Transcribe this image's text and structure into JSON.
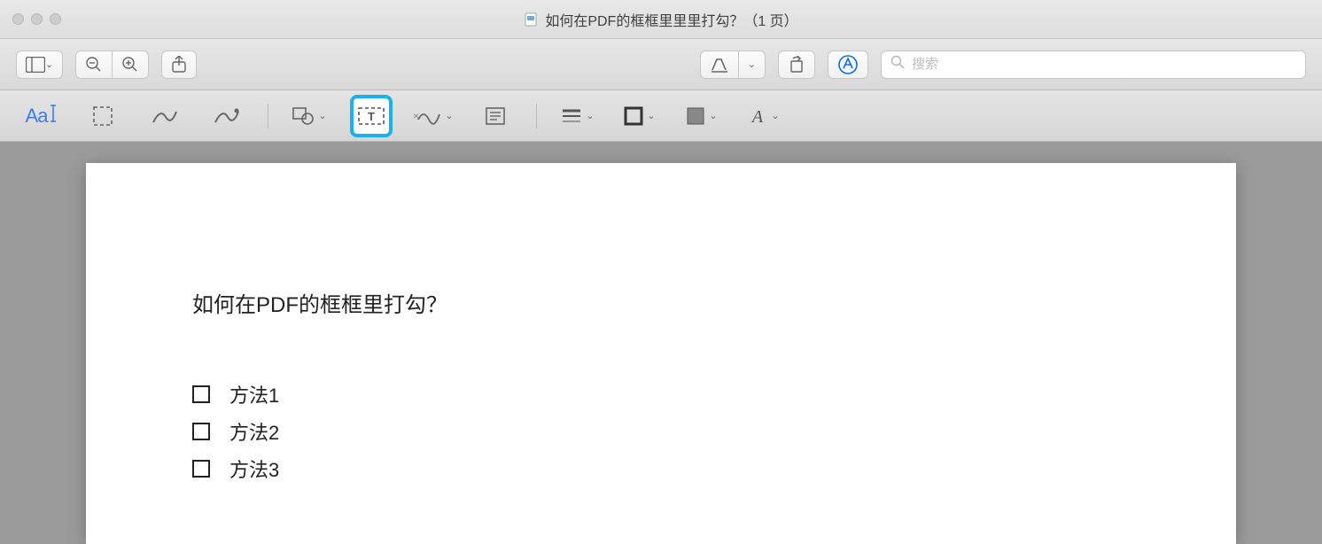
{
  "window": {
    "title": "如何在PDF的框框里里里打勾？（1 页）"
  },
  "toolbar": {
    "search_placeholder": "搜索"
  },
  "markup": {
    "text_tool_label": "Aa"
  },
  "document": {
    "heading": "如何在PDF的框框里打勾？",
    "items": [
      {
        "label": "方法1"
      },
      {
        "label": "方法2"
      },
      {
        "label": "方法3"
      }
    ]
  }
}
